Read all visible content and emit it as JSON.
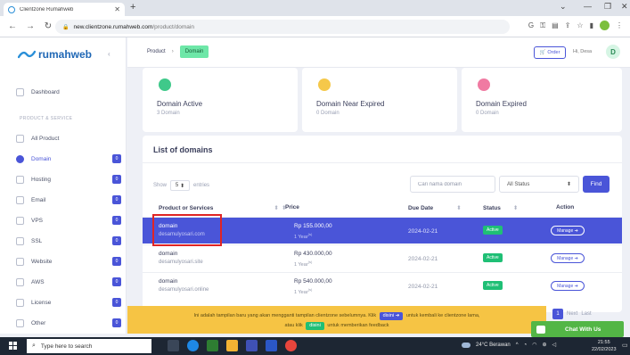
{
  "browser": {
    "tab_title": "Clientzone Rumahweb",
    "url_host": "new.clientzone.rumahweb.com",
    "url_path": "/product/domain"
  },
  "sidebar": {
    "brand": "rumahweb",
    "section_label": "PRODUCT & SERVICE",
    "items": [
      {
        "label": "Dashboard",
        "icon": "home-icon",
        "badge": ""
      },
      {
        "label": "All Product",
        "icon": "box-icon",
        "badge": ""
      },
      {
        "label": "Domain",
        "icon": "globe-icon",
        "badge": "0",
        "active": true
      },
      {
        "label": "Hosting",
        "icon": "server-icon",
        "badge": "0"
      },
      {
        "label": "Email",
        "icon": "mail-icon",
        "badge": "0"
      },
      {
        "label": "VPS",
        "icon": "vps-icon",
        "badge": "0"
      },
      {
        "label": "SSL",
        "icon": "lock-icon",
        "badge": "0"
      },
      {
        "label": "Website",
        "icon": "website-icon",
        "badge": "0"
      },
      {
        "label": "AWS",
        "icon": "cloud-icon",
        "badge": "0"
      },
      {
        "label": "License",
        "icon": "license-icon",
        "badge": "0"
      },
      {
        "label": "Other",
        "icon": "other-icon",
        "badge": "0"
      }
    ]
  },
  "header": {
    "breadcrumb_product": "Product",
    "breadcrumb_sep": "›",
    "breadcrumb_domain": "Domain",
    "order_label": "Order",
    "greeting": "Hi, Desa",
    "avatar_letter": "D"
  },
  "stats": [
    {
      "title": "Domain Active",
      "sub": "3 Domain",
      "color": "#3fc98a"
    },
    {
      "title": "Domain Near Expired",
      "sub": "0 Domain",
      "color": "#f5c84a"
    },
    {
      "title": "Domain Expired",
      "sub": "0 Domain",
      "color": "#f07aa2"
    }
  ],
  "list": {
    "title": "List of domains",
    "show_label": "Show",
    "entries_value": "5",
    "entries_label": "entries",
    "search_placeholder": "Cari nama domain",
    "status_value": "All Status",
    "find_label": "Find",
    "columns": [
      "Product or Services",
      "Price",
      "Due Date",
      "Status",
      "Action"
    ],
    "rows": [
      {
        "name": "domain",
        "domain": "desamulyosari.com",
        "price": "Rp 155.000,00",
        "period": "1 Year",
        "period_sup": "(s)",
        "due": "2024-02-21",
        "status": "Active",
        "action": "Manage ➔",
        "selected": true
      },
      {
        "name": "domain",
        "domain": "desamulyosari.site",
        "price": "Rp 430.000,00",
        "period": "1 Year",
        "period_sup": "(s)",
        "due": "2024-02-21",
        "status": "Active",
        "action": "Manage ➔"
      },
      {
        "name": "domain",
        "domain": "desamulyosari.online",
        "price": "Rp 540.000,00",
        "period": "1 Year",
        "period_sup": "(s)",
        "due": "2024-02-21",
        "status": "Active",
        "action": "Manage ➔"
      }
    ]
  },
  "notice": {
    "text_1": "Ini adalah tampilan baru yang akan mengganti tampilan clientzone sebelumnya. Klik",
    "pill_1": "disini ➔",
    "text_2": "untuk kembali ke clientzone lama,",
    "text_3": "atau klik",
    "pill_2": "disini",
    "text_4": "untuk memberikan feedback"
  },
  "pager": {
    "page": "1",
    "next": "Next",
    "last": "Last"
  },
  "chat_label": "Chat With Us",
  "taskbar": {
    "search_placeholder": "Type here to search",
    "weather": "24°C Berawan",
    "time": "21:55",
    "date": "22/02/2023"
  },
  "colors": {
    "accent": "#4a55d8",
    "success": "#1fbf75",
    "notice": "#f6c444",
    "chat": "#53b646",
    "highlight": "#e02424"
  }
}
